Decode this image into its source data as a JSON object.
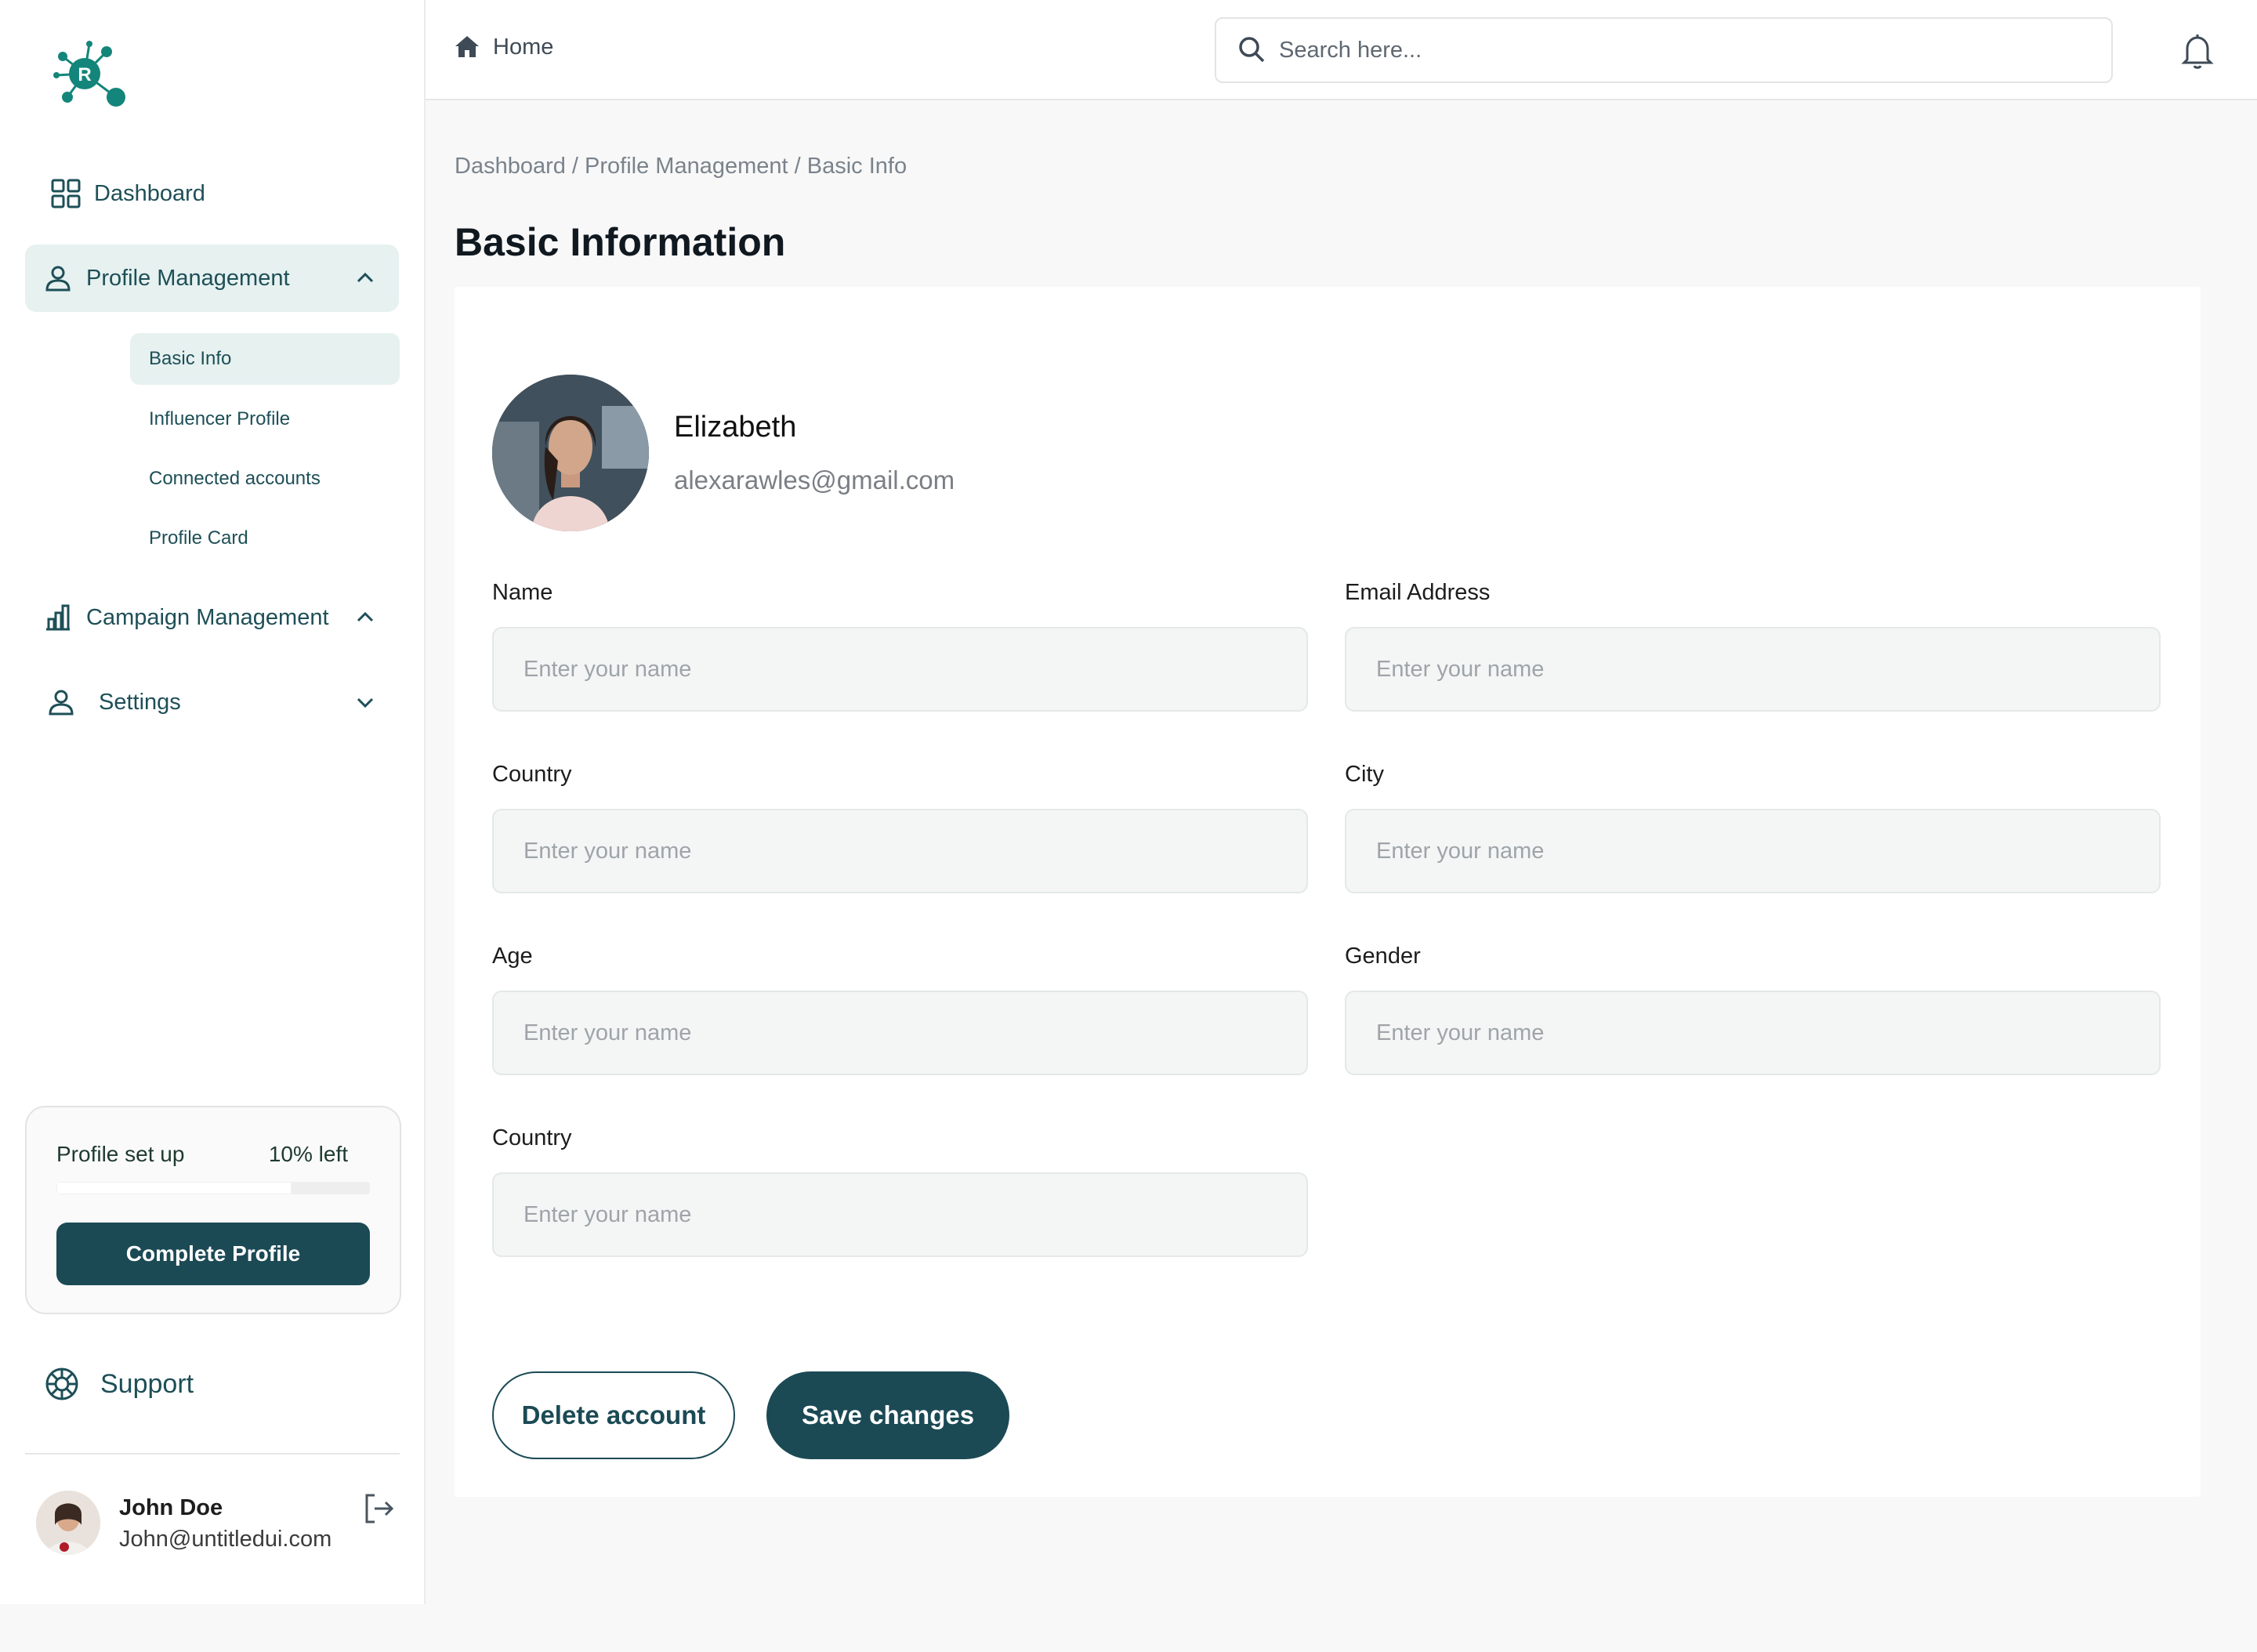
{
  "sidebar": {
    "nav": {
      "dashboard": "Dashboard",
      "profile_management": "Profile Management",
      "campaign_management": "Campaign Management",
      "settings": "Settings"
    },
    "profile_sub": {
      "basic_info": "Basic Info",
      "influencer_profile": "Influencer Profile",
      "connected_accounts": "Connected accounts",
      "profile_card": "Profile Card"
    },
    "setup": {
      "label": "Profile set up",
      "left_text": "10% left",
      "progress": 0.75,
      "button": "Complete Profile"
    },
    "support": "Support",
    "user": {
      "name": "John Doe",
      "email": "John@untitledui.com"
    }
  },
  "topbar": {
    "home": "Home",
    "search_placeholder": "Search here..."
  },
  "main": {
    "breadcrumb": "Dashboard / Profile Management  / Basic Info",
    "title": "Basic Information",
    "profile": {
      "name": "Elizabeth",
      "email": "alexarawles@gmail.com"
    },
    "fields": {
      "name": {
        "label": "Name",
        "placeholder": "Enter your name"
      },
      "email": {
        "label": "Email Address",
        "placeholder": "Enter your name"
      },
      "country": {
        "label": "Country",
        "placeholder": "Enter your name"
      },
      "city": {
        "label": "City",
        "placeholder": "Enter your name"
      },
      "age": {
        "label": "Age",
        "placeholder": "Enter your name"
      },
      "gender": {
        "label": "Gender",
        "placeholder": "Enter your name"
      },
      "country2": {
        "label": "Country",
        "placeholder": "Enter your name"
      }
    },
    "buttons": {
      "delete": "Delete account",
      "save": "Save changes"
    }
  },
  "colors": {
    "brand": "#1b4a55",
    "accent_light": "#e6f1f0",
    "logo": "#14857a"
  },
  "icons": {
    "logo": "molecule-logo",
    "dashboard": "grid-icon",
    "profile": "user-icon",
    "campaign": "bar-chart-icon",
    "settings": "user-icon",
    "support": "lifebuoy-icon",
    "logout": "logout-icon",
    "home": "home-icon",
    "search": "search-icon",
    "bell": "bell-icon"
  }
}
